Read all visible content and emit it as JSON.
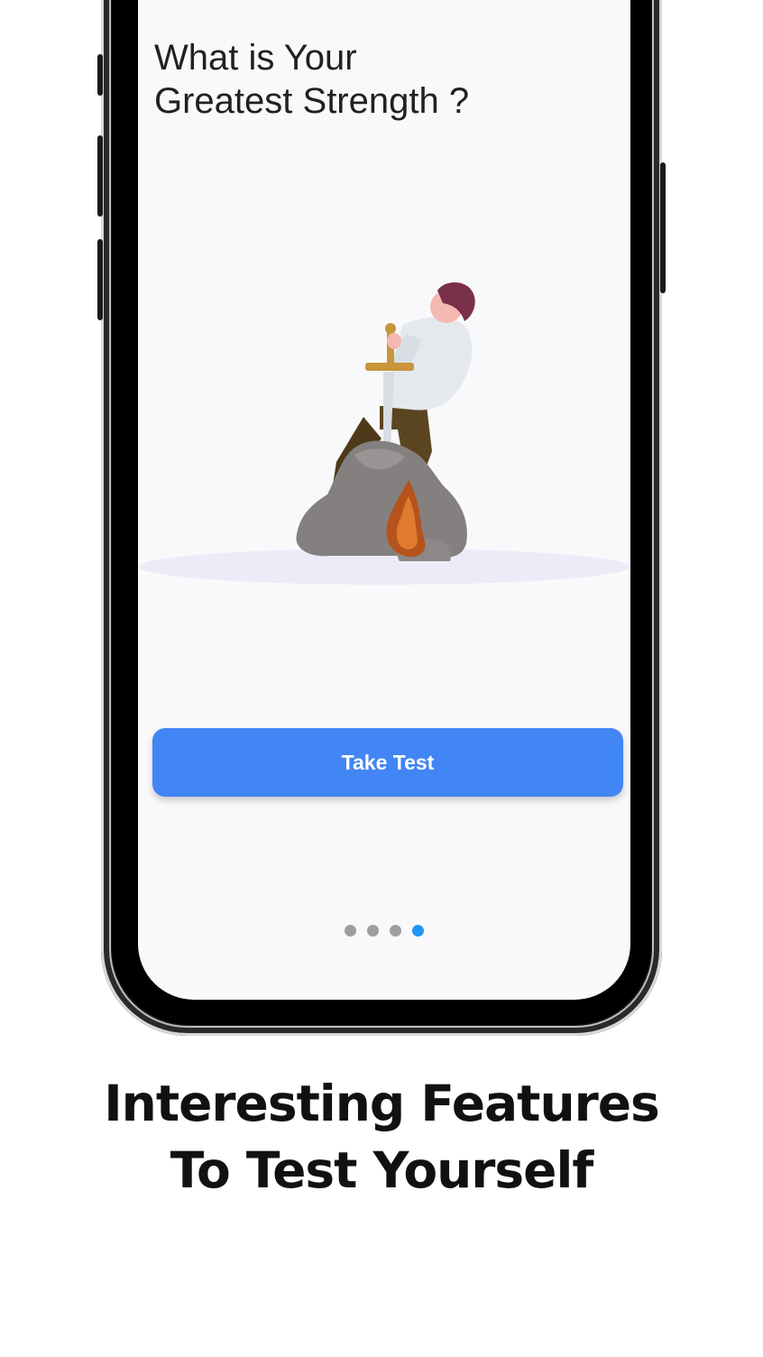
{
  "screen": {
    "headline_line1": "What is Your",
    "headline_line2": "Greatest Strength ?",
    "illustration": "person-pulling-sword-from-stone",
    "cta_label": "Take Test",
    "pager": {
      "total": 4,
      "active_index": 3
    }
  },
  "tagline": {
    "line1": "Interesting Features",
    "line2": "To Test Yourself"
  },
  "colors": {
    "button": "#4285f4",
    "dot_active": "#2196f3",
    "dot_inactive": "#9e9e9e",
    "screen_bg": "#f9f9fb"
  }
}
